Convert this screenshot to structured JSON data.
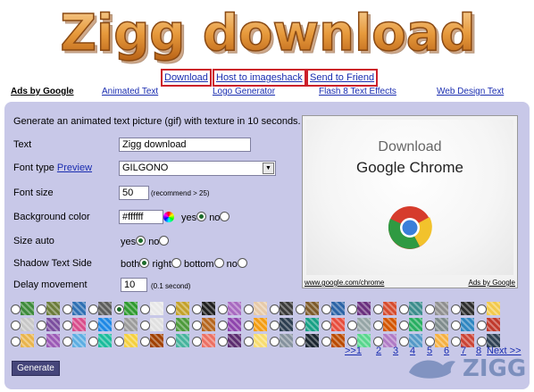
{
  "logo": {
    "text": "Zigg download"
  },
  "actions": [
    {
      "label": "Download"
    },
    {
      "label": "Host to imageshack"
    },
    {
      "label": "Send to Friend"
    }
  ],
  "ads": {
    "label": "Ads by Google",
    "links": [
      "Animated Text",
      "Logo Generator",
      "Flash 8 Text Effects",
      "Web Design Text"
    ]
  },
  "form": {
    "intro": "Generate an animated text picture (gif) with texture in 10 seconds.",
    "text_label": "Text",
    "text_value": "Zigg download",
    "font_label": "Font type",
    "preview_link": "Preview",
    "font_value": "GILGONO",
    "size_label": "Font size",
    "size_value": "50",
    "size_note": "(recommend > 25)",
    "bg_label": "Background color",
    "bg_value": "#ffffff",
    "bg_yes": "yes",
    "bg_no": "no",
    "bg_selected": "yes",
    "auto_label": "Size auto",
    "auto_yes": "yes",
    "auto_no": "no",
    "auto_selected": "yes",
    "shadow_label": "Shadow Text Side",
    "shadow_options": [
      "both",
      "right",
      "bottom",
      "no"
    ],
    "shadow_selected": "both",
    "delay_label": "Delay movement",
    "delay_value": "10",
    "delay_note": "(0.1 second)",
    "generate_label": "Generate"
  },
  "preview": {
    "line1": "Download",
    "line2": "Google Chrome",
    "footer_left": "www.google.com/chrome",
    "footer_right": "Ads by Google"
  },
  "pager": {
    "first": ">>1",
    "pages": [
      "2",
      "3",
      "4",
      "5",
      "6",
      "7",
      "8"
    ],
    "next": "Next >>"
  },
  "watermark": {
    "text": "ZIGG"
  },
  "textures": {
    "selected_index": 4,
    "colors": [
      "#3d8a3b",
      "#6b7c3a",
      "#2e6fb3",
      "#5c5c5c",
      "#2f9a2f",
      "#e8e8e8",
      "#c3a12a",
      "#1f1f1f",
      "#a86ac1",
      "#e6c9a8",
      "#3a3a3a",
      "#7d5a2a",
      "#2b63a6",
      "#6a2f7e",
      "#d64a2d",
      "#3b8c8c",
      "#8f8f8f",
      "#2c2c2c",
      "#f2c94c",
      "#c7c7c7",
      "#7a4d9e",
      "#d84c8b",
      "#1e88e5",
      "#9b9b9b",
      "#e0e0e0",
      "#4c9a3b",
      "#b5651d",
      "#8e44ad",
      "#f39c12",
      "#2c3e50",
      "#16a085",
      "#e74c3c",
      "#95a5a6",
      "#d35400",
      "#27ae60",
      "#7f8c8d",
      "#2e86c1",
      "#c0392b",
      "#e9b44c",
      "#9b59b6",
      "#5dade2",
      "#1abc9c",
      "#f4d03f",
      "#a04000",
      "#45b39d",
      "#ec7063",
      "#5b2c6f",
      "#f7dc6f",
      "#85929e",
      "#1b2631",
      "#ba4a00",
      "#58d68d",
      "#af7ac5",
      "#5499c7",
      "#f5b041",
      "#cb4335",
      "#2e4053"
    ]
  }
}
